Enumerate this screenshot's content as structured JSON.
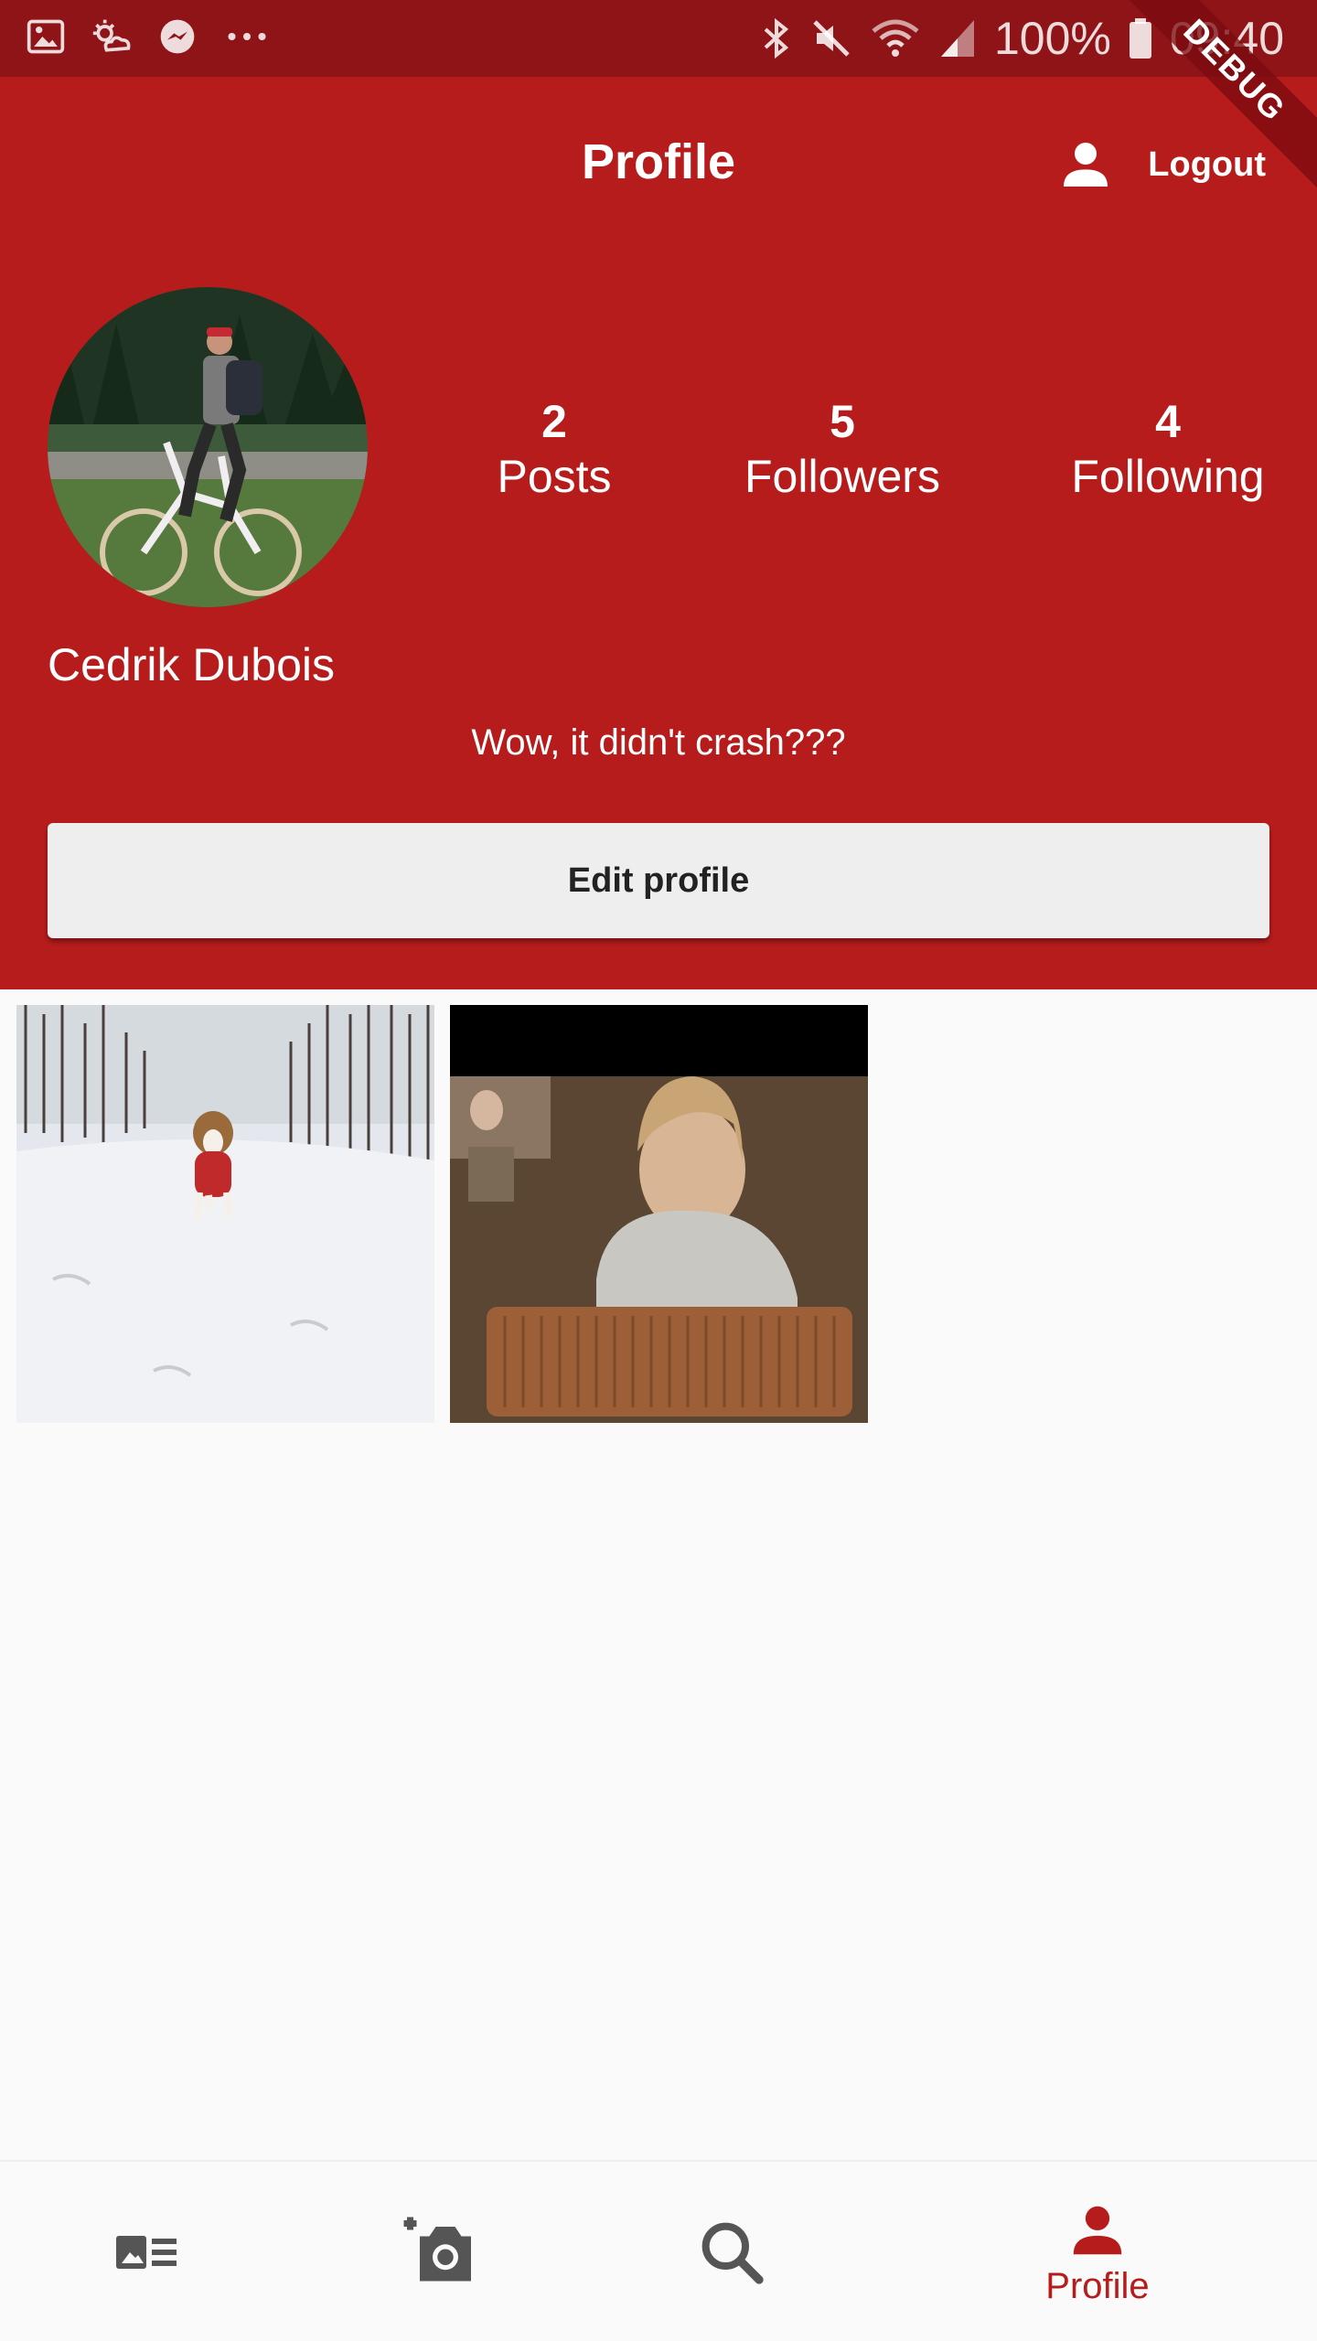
{
  "status_bar": {
    "battery": "100%",
    "time": "09:40"
  },
  "debug_banner": "DEBUG",
  "header": {
    "title": "Profile",
    "logout_label": "Logout"
  },
  "profile": {
    "name": "Cedrik Dubois",
    "bio": "Wow, it didn't crash???",
    "stats": [
      {
        "value": "2",
        "label": "Posts"
      },
      {
        "value": "5",
        "label": "Followers"
      },
      {
        "value": "4",
        "label": "Following"
      }
    ],
    "edit_button": "Edit profile"
  },
  "bottom_nav": {
    "items": [
      {
        "icon": "feed-icon",
        "label": ""
      },
      {
        "icon": "add-photo-icon",
        "label": ""
      },
      {
        "icon": "search-icon",
        "label": ""
      },
      {
        "icon": "person-icon",
        "label": "Profile"
      }
    ],
    "active_index": 3
  },
  "colors": {
    "primary": "#b71c1c",
    "status_bar": "#8f1418",
    "background": "#fafafa",
    "nav_inactive": "#555555"
  }
}
